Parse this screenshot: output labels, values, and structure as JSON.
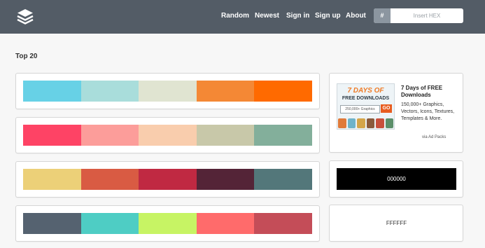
{
  "nav": {
    "items": [
      {
        "label": "Random"
      },
      {
        "label": "Newest"
      },
      {
        "label": "Sign in"
      },
      {
        "label": "Sign up"
      },
      {
        "label": "About"
      }
    ],
    "search": {
      "hash": "#",
      "placeholder": "Insert HEX"
    }
  },
  "heading": "Top 20",
  "palettes": [
    {
      "colors": [
        "#67d1e6",
        "#a9dddb",
        "#e0e4d1",
        "#f48835",
        "#ff6a00"
      ]
    },
    {
      "colors": [
        "#fe4365",
        "#fc9d9a",
        "#f9cdad",
        "#c8c8a9",
        "#83af9b"
      ]
    },
    {
      "colors": [
        "#ecd078",
        "#d95b43",
        "#c02942",
        "#542437",
        "#53777a"
      ]
    },
    {
      "colors": [
        "#556270",
        "#4ecdc4",
        "#c7f464",
        "#ff6b6b",
        "#c44d58"
      ]
    }
  ],
  "ad": {
    "image_title": "7 DAYS OF",
    "image_sub": "FREE DOWNLOADS",
    "image_input": "250,000+ Graphics",
    "image_go": "GO",
    "title": "7 Days of FREE Downloads",
    "desc": "150,000+ Graphics, Vectors, Icons, Textures, Templates & More.",
    "via": "via Ad Packs"
  },
  "single_black": {
    "label": "000000",
    "color": "#000000"
  },
  "single_white": {
    "label": "FFFFFF",
    "color": "#ffffff"
  },
  "colors": {
    "header": "#535c66",
    "background": "#f7f7f7"
  }
}
